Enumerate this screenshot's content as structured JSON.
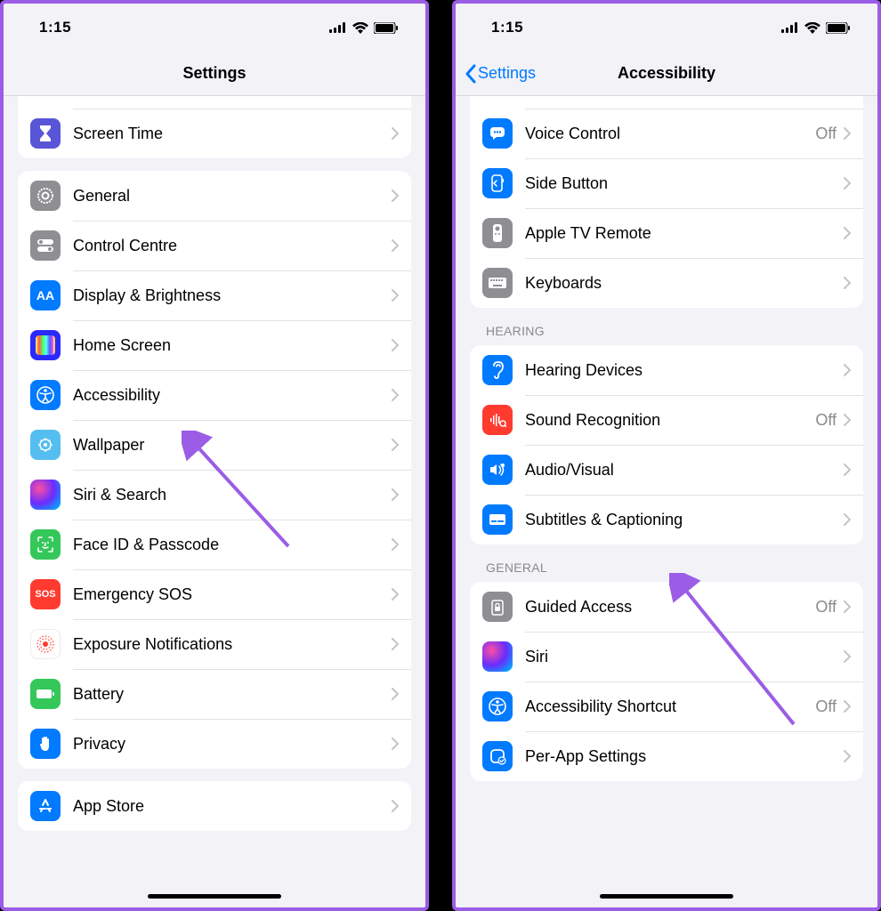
{
  "statusbar": {
    "time": "1:15"
  },
  "left": {
    "title": "Settings",
    "groups": [
      {
        "peek": true,
        "items": [
          {
            "label": "Screen Time",
            "icon": "hourglass-icon",
            "bg": "purple"
          }
        ]
      },
      {
        "items": [
          {
            "label": "General",
            "icon": "gear-icon",
            "bg": "gray"
          },
          {
            "label": "Control Centre",
            "icon": "switches-icon",
            "bg": "gray"
          },
          {
            "label": "Display & Brightness",
            "icon": "aa-icon",
            "bg": "blue"
          },
          {
            "label": "Home Screen",
            "icon": "grid-icon",
            "bg": "darkblue"
          },
          {
            "label": "Accessibility",
            "icon": "accessibility-icon",
            "bg": "blue"
          },
          {
            "label": "Wallpaper",
            "icon": "wallpaper-icon",
            "bg": "cyan"
          },
          {
            "label": "Siri & Search",
            "icon": "siri-icon",
            "bg": "siri"
          },
          {
            "label": "Face ID & Passcode",
            "icon": "faceid-icon",
            "bg": "green"
          },
          {
            "label": "Emergency SOS",
            "icon": "sos-icon",
            "bg": "red"
          },
          {
            "label": "Exposure Notifications",
            "icon": "exposure-icon",
            "bg": "white-red"
          },
          {
            "label": "Battery",
            "icon": "battery-icon",
            "bg": "green"
          },
          {
            "label": "Privacy",
            "icon": "hand-icon",
            "bg": "blue"
          }
        ]
      },
      {
        "items": [
          {
            "label": "App Store",
            "icon": "appstore-icon",
            "bg": "blue"
          }
        ]
      }
    ]
  },
  "right": {
    "back": "Settings",
    "title": "Accessibility",
    "groups": [
      {
        "peek": true,
        "items": [
          {
            "label": "Voice Control",
            "icon": "voice-icon",
            "bg": "blue",
            "value": "Off"
          },
          {
            "label": "Side Button",
            "icon": "sidebutton-icon",
            "bg": "blue"
          },
          {
            "label": "Apple TV Remote",
            "icon": "remote-icon",
            "bg": "gray"
          },
          {
            "label": "Keyboards",
            "icon": "keyboard-icon",
            "bg": "gray"
          }
        ]
      },
      {
        "header": "HEARING",
        "items": [
          {
            "label": "Hearing Devices",
            "icon": "ear-icon",
            "bg": "blue"
          },
          {
            "label": "Sound Recognition",
            "icon": "sound-icon",
            "bg": "red",
            "value": "Off"
          },
          {
            "label": "Audio/Visual",
            "icon": "audiovisual-icon",
            "bg": "blue"
          },
          {
            "label": "Subtitles & Captioning",
            "icon": "subtitles-icon",
            "bg": "blue"
          }
        ]
      },
      {
        "header": "GENERAL",
        "items": [
          {
            "label": "Guided Access",
            "icon": "lock-icon",
            "bg": "gray",
            "value": "Off"
          },
          {
            "label": "Siri",
            "icon": "siri-icon",
            "bg": "siri"
          },
          {
            "label": "Accessibility Shortcut",
            "icon": "accessibility-icon",
            "bg": "blue",
            "value": "Off"
          },
          {
            "label": "Per-App Settings",
            "icon": "perapp-icon",
            "bg": "blue"
          }
        ]
      }
    ]
  }
}
